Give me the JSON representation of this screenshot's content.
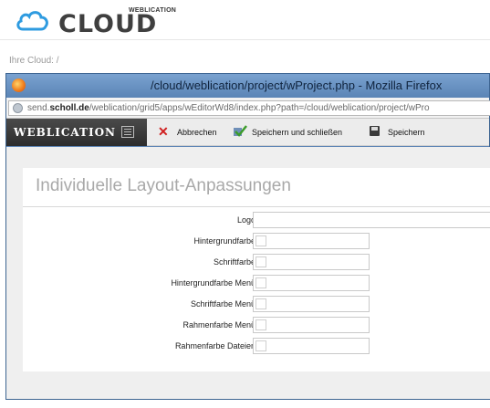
{
  "brand": {
    "small": "WEBLICATION",
    "big": "CLOUD"
  },
  "breadcrumb": "Ihre Cloud: /",
  "firefox": {
    "title": "/cloud/weblication/project/wProject.php - Mozilla Firefox",
    "url_prefix": "send.",
    "url_domain": "scholl.de",
    "url_path": "/weblication/grid5/apps/wEditorWd8/index.php?path=/cloud/weblication/project/wPro"
  },
  "toolbar": {
    "logo": "WEBLICATION",
    "cancel": "Abbrechen",
    "save_close": "Speichern und schließen",
    "save": "Speichern"
  },
  "panel": {
    "title": "Individuelle Layout-Anpassungen"
  },
  "fields": [
    {
      "label": "Logo",
      "value": ""
    },
    {
      "label": "Hintergrundfarbe",
      "value": ""
    },
    {
      "label": "Schriftfarbe",
      "value": ""
    },
    {
      "label": "Hintergrundfarbe Menü",
      "value": ""
    },
    {
      "label": "Schriftfarbe Menü",
      "value": ""
    },
    {
      "label": "Rahmenfarbe Menü",
      "value": ""
    },
    {
      "label": "Rahmenfarbe Dateien",
      "value": ""
    }
  ]
}
